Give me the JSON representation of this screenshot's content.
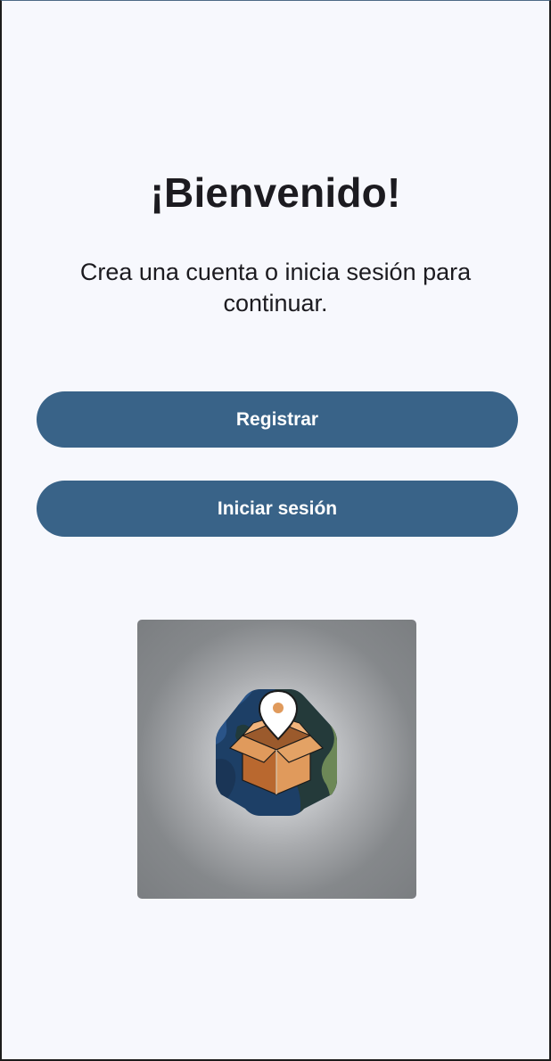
{
  "welcome": {
    "title": "¡Bienvenido!",
    "subtitle": "Crea una cuenta o inicia sesión para continuar."
  },
  "actions": {
    "register_label": "Registrar",
    "login_label": "Iniciar sesión"
  },
  "logo": {
    "icon": "globe-box-location-icon"
  },
  "colors": {
    "background": "#f7f8fd",
    "button": "#396388",
    "button_text": "#ffffff",
    "text": "#1c1b20",
    "box_orange": "#e09a5c",
    "globe_blue": "#21497a",
    "globe_green": "#6f8a58"
  }
}
